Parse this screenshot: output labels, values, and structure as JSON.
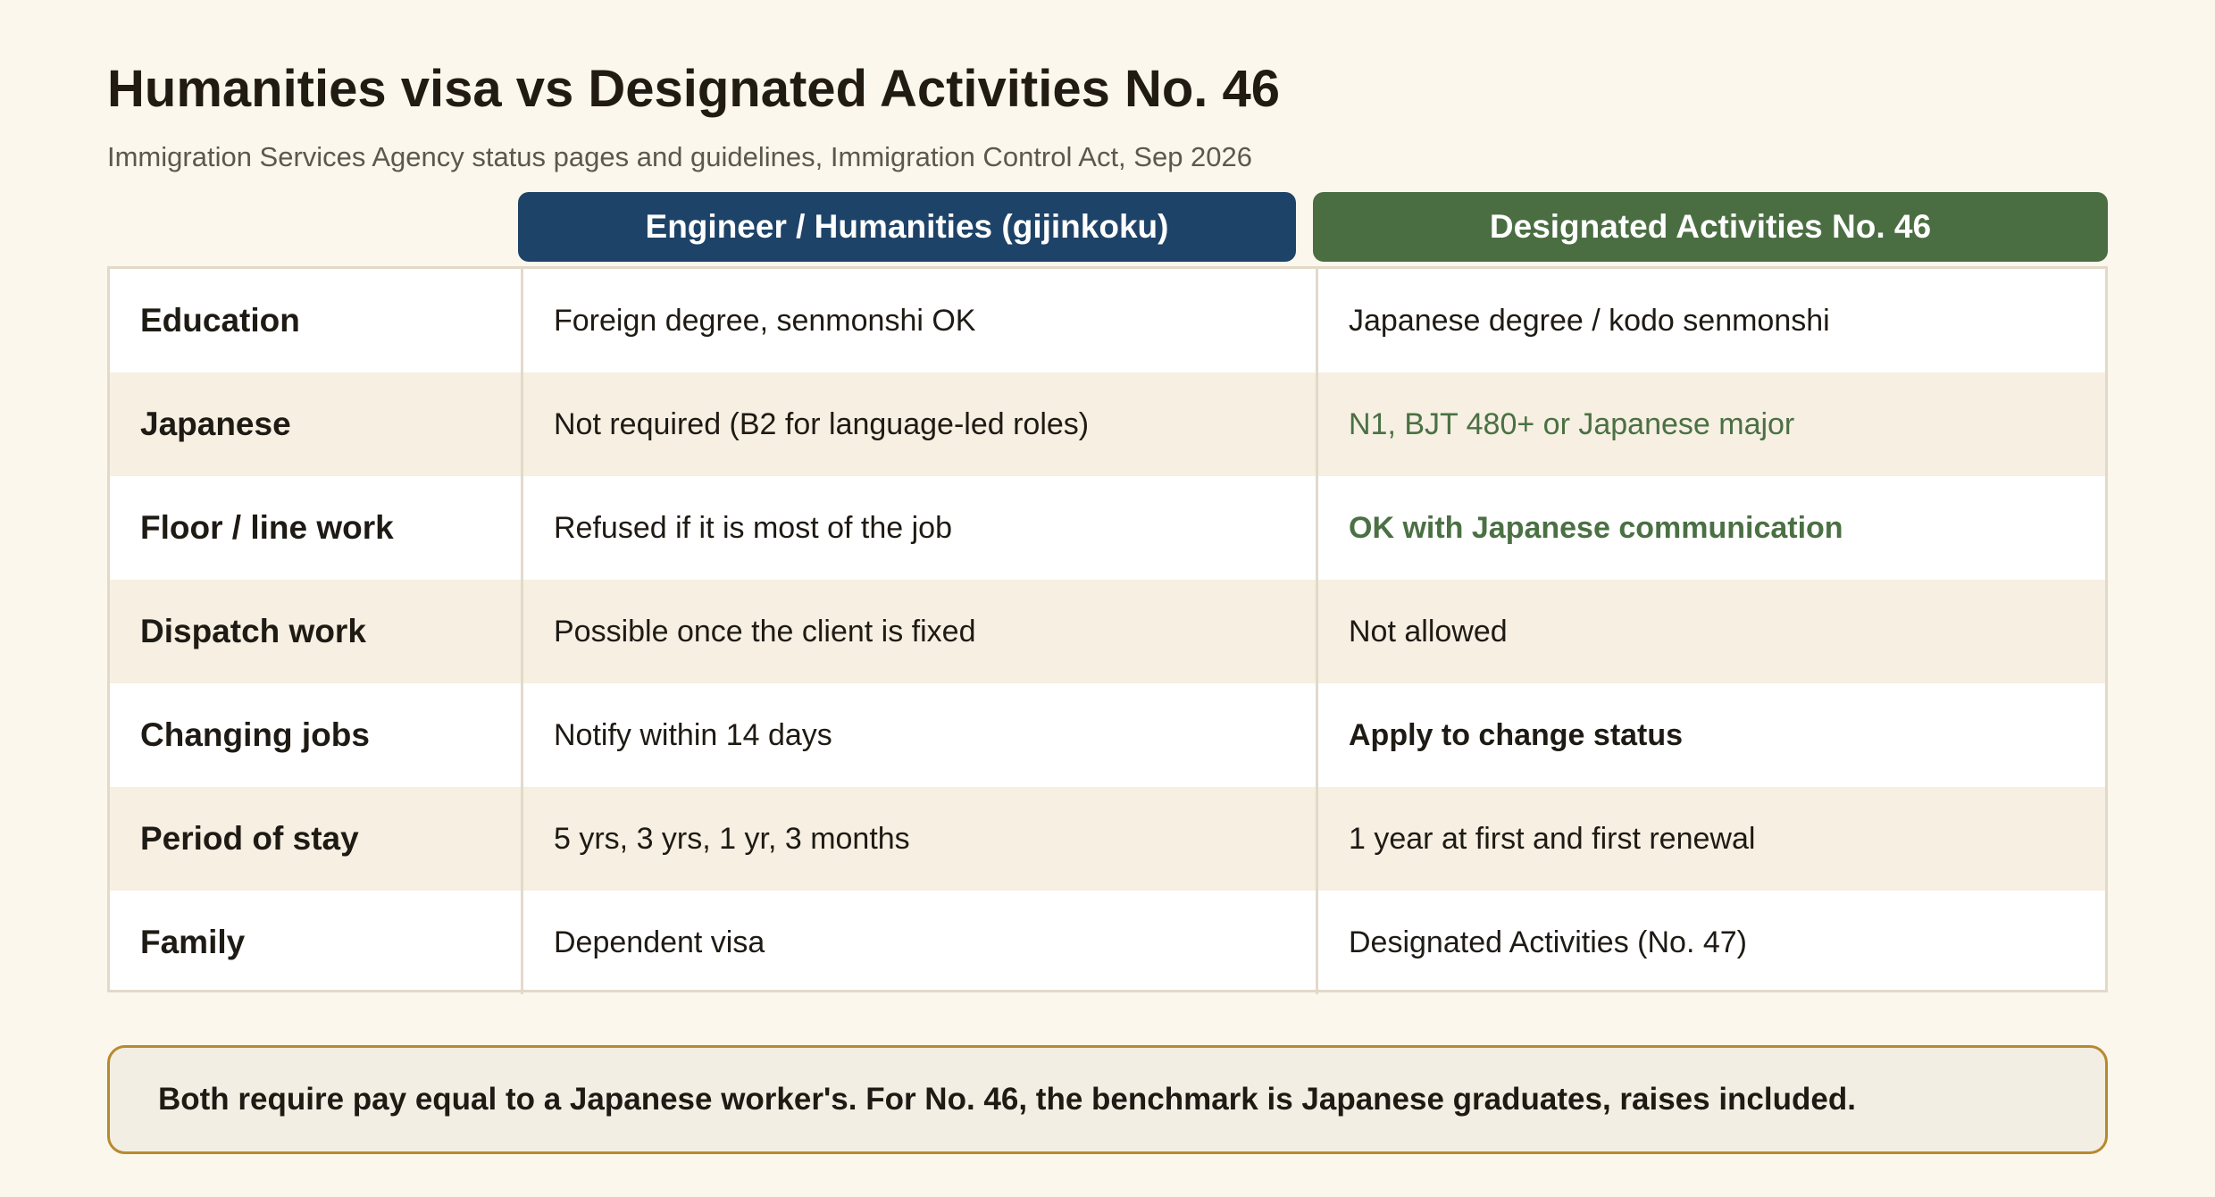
{
  "header": {
    "title": "Humanities visa vs Designated Activities No. 46",
    "subtitle": "Immigration Services Agency status pages and guidelines, Immigration Control Act, Sep 2026"
  },
  "columns": {
    "a": "Engineer / Humanities (gijinkoku)",
    "b": "Designated Activities No. 46"
  },
  "rows": [
    {
      "label": "Education",
      "a": "Foreign degree, senmonshi OK",
      "b": "Japanese degree / kodo senmonshi"
    },
    {
      "label": "Japanese",
      "a": "Not required (B2 for language-led roles)",
      "b": "N1, BJT 480+ or Japanese major"
    },
    {
      "label": "Floor / line work",
      "a": "Refused if it is most of the job",
      "b": "OK with Japanese communication"
    },
    {
      "label": "Dispatch work",
      "a": "Possible once the client is fixed",
      "b": "Not allowed"
    },
    {
      "label": "Changing jobs",
      "a": "Notify within 14 days",
      "b": "Apply to change status"
    },
    {
      "label": "Period of stay",
      "a": "5 yrs, 3 yrs, 1 yr, 3 months",
      "b": "1 year at first and first renewal"
    },
    {
      "label": "Family",
      "a": "Dependent visa",
      "b": "Designated Activities (No. 47)"
    }
  ],
  "note": "Both require pay equal to a Japanese worker's. For No. 46, the benchmark is Japanese graduates, raises included.",
  "colors": {
    "background": "#fbf7ec",
    "column_a_header": "#1e4368",
    "column_b_header": "#4a6e42",
    "highlight_green": "#4a7043",
    "note_border": "#b8892f"
  }
}
